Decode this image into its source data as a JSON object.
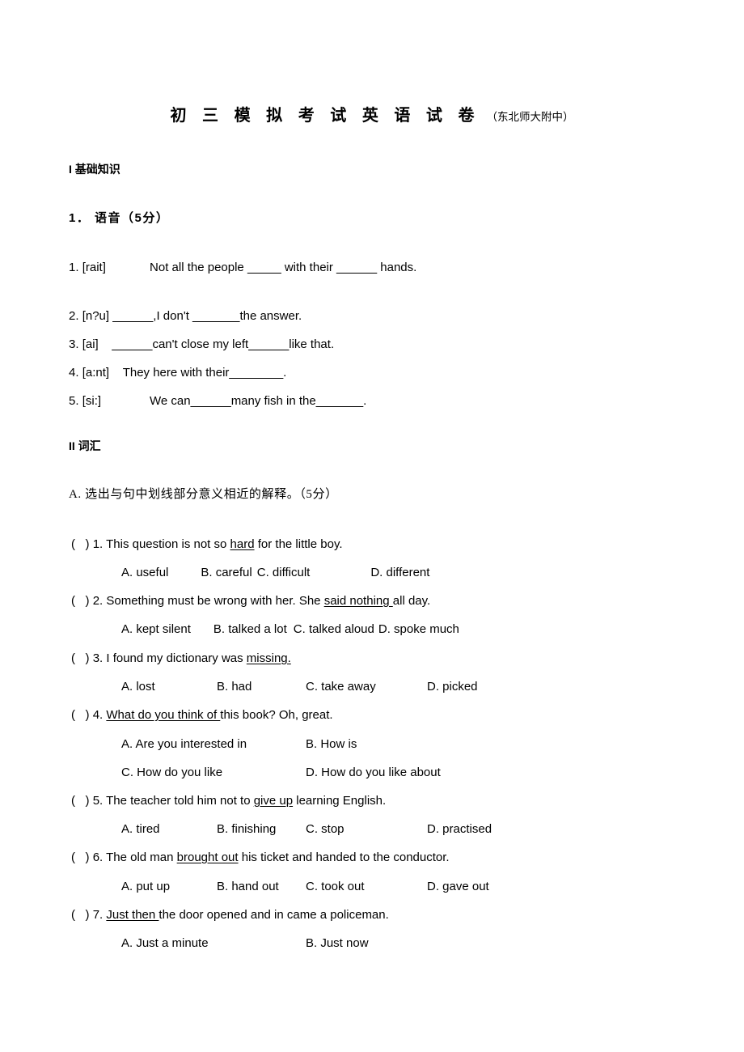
{
  "document": {
    "title_main": "初 三 模 拟 考 试 英 语 试 卷",
    "title_sub": "（东北师大附中）"
  },
  "sections": {
    "part1_heading": "I 基础知识",
    "part1_sub_heading": "1． 语音（5分）",
    "part2_heading": "II 词汇",
    "part2_sub_heading": "A. 选出与句中划线部分意义相近的解释。（5分）"
  },
  "phonetics": {
    "items": [
      {
        "number": "1.",
        "symbol": "[rait]",
        "before": "Not all the people ",
        "blank1": "_____",
        "middle": " with their ",
        "blank2": "______",
        "after": " hands."
      },
      {
        "number": "2.",
        "symbol": "[n?u]",
        "before": " ",
        "blank1": "______",
        "middle": ",I don't ",
        "blank2": "_______",
        "after": "the answer."
      },
      {
        "number": "3.",
        "symbol": "[ai]",
        "before": "    ",
        "blank1": "______",
        "middle": "can't close my left",
        "blank2": "______",
        "after": "like that."
      },
      {
        "number": "4.",
        "symbol": "[a:nt]",
        "before": "They here with their",
        "blank1": "________",
        "middle": "",
        "blank2": "",
        "after": "."
      },
      {
        "number": "5.",
        "symbol": "[si:]",
        "before": "We can",
        "blank1": "______",
        "middle": "many fish in the",
        "blank2": "_______",
        "after": "."
      }
    ]
  },
  "vocabulary": {
    "marker_open": "(",
    "marker_close": ")",
    "questions": [
      {
        "number": "1.",
        "stem_before": "This question is not so ",
        "stem_underlined": "hard",
        "stem_after": " for the little boy.",
        "options_lines": [
          {
            "a": "A. useful",
            "b": "B. careful",
            "c": "C. difficult",
            "d": "D. different"
          }
        ],
        "layout": "wide"
      },
      {
        "number": "2.",
        "stem_before": "Something must be wrong with her. She ",
        "stem_underlined": "said nothing ",
        "stem_after": "all day.",
        "options_lines": [
          {
            "a": "A. kept silent",
            "b": "B. talked a lot",
            "c": "C. talked aloud",
            "d": "D. spoke much"
          }
        ],
        "layout": "tight"
      },
      {
        "number": "3.",
        "stem_before": "I found my dictionary was ",
        "stem_underlined": "missing.",
        "stem_after": "",
        "options_lines": [
          {
            "a": "A. lost",
            "b": "B. had",
            "c": "C. take away",
            "d": "D. picked"
          }
        ],
        "layout": "wide"
      },
      {
        "number": "4.",
        "stem_before": "",
        "stem_underlined": "What do you think of ",
        "stem_after": "this book? Oh, great.",
        "options_lines": [
          {
            "a": "A. Are you interested in",
            "b": "B. How is"
          },
          {
            "a": "C. How do you like",
            "b": "D. How do you like about"
          }
        ],
        "layout": "two-column"
      },
      {
        "number": "5.",
        "stem_before": "The teacher told him not to ",
        "stem_underlined": "give up",
        "stem_after": " learning English.",
        "options_lines": [
          {
            "a": "A. tired",
            "b": "B. finishing",
            "c": "C. stop",
            "d": "D. practised"
          }
        ],
        "layout": "wide"
      },
      {
        "number": "6.",
        "stem_before": "The old man ",
        "stem_underlined": "brought out",
        "stem_after": " his ticket and handed to the conductor.",
        "options_lines": [
          {
            "a": "A. put up",
            "b": "B. hand out",
            "c": "C. took out",
            "d": "D. gave out"
          }
        ],
        "layout": "wide"
      },
      {
        "number": "7.",
        "stem_before": "",
        "stem_underlined": "Just then ",
        "stem_after": "the door opened and in came a policeman.",
        "options_lines": [
          {
            "a": "A. Just a minute",
            "b": "B. Just now"
          }
        ],
        "layout": "two-column"
      }
    ]
  }
}
